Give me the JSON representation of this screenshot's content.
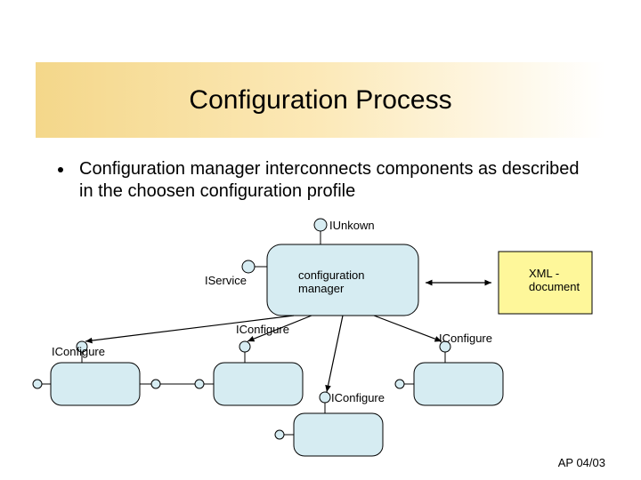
{
  "slide": {
    "title": "Configuration Process",
    "bullet": "Configuration manager interconnects components as described in the choosen configuration profile",
    "footer": "AP 04/03"
  },
  "diagram": {
    "labels": {
      "iunknown": "IUnkown",
      "iservice": "IService",
      "config_manager": "configuration manager",
      "xml_doc_l1": "XML -",
      "xml_doc_l2": "document",
      "iconfigure_upper": "IConfigure",
      "iconfigure_right": "IConfigure",
      "iconfigure_left": "IConfigure",
      "iconfigure_bottom": "IConfigure"
    },
    "colors": {
      "component_fill": "#d6ecf2",
      "doc_fill": "#fef79a",
      "stroke": "#000000"
    }
  }
}
